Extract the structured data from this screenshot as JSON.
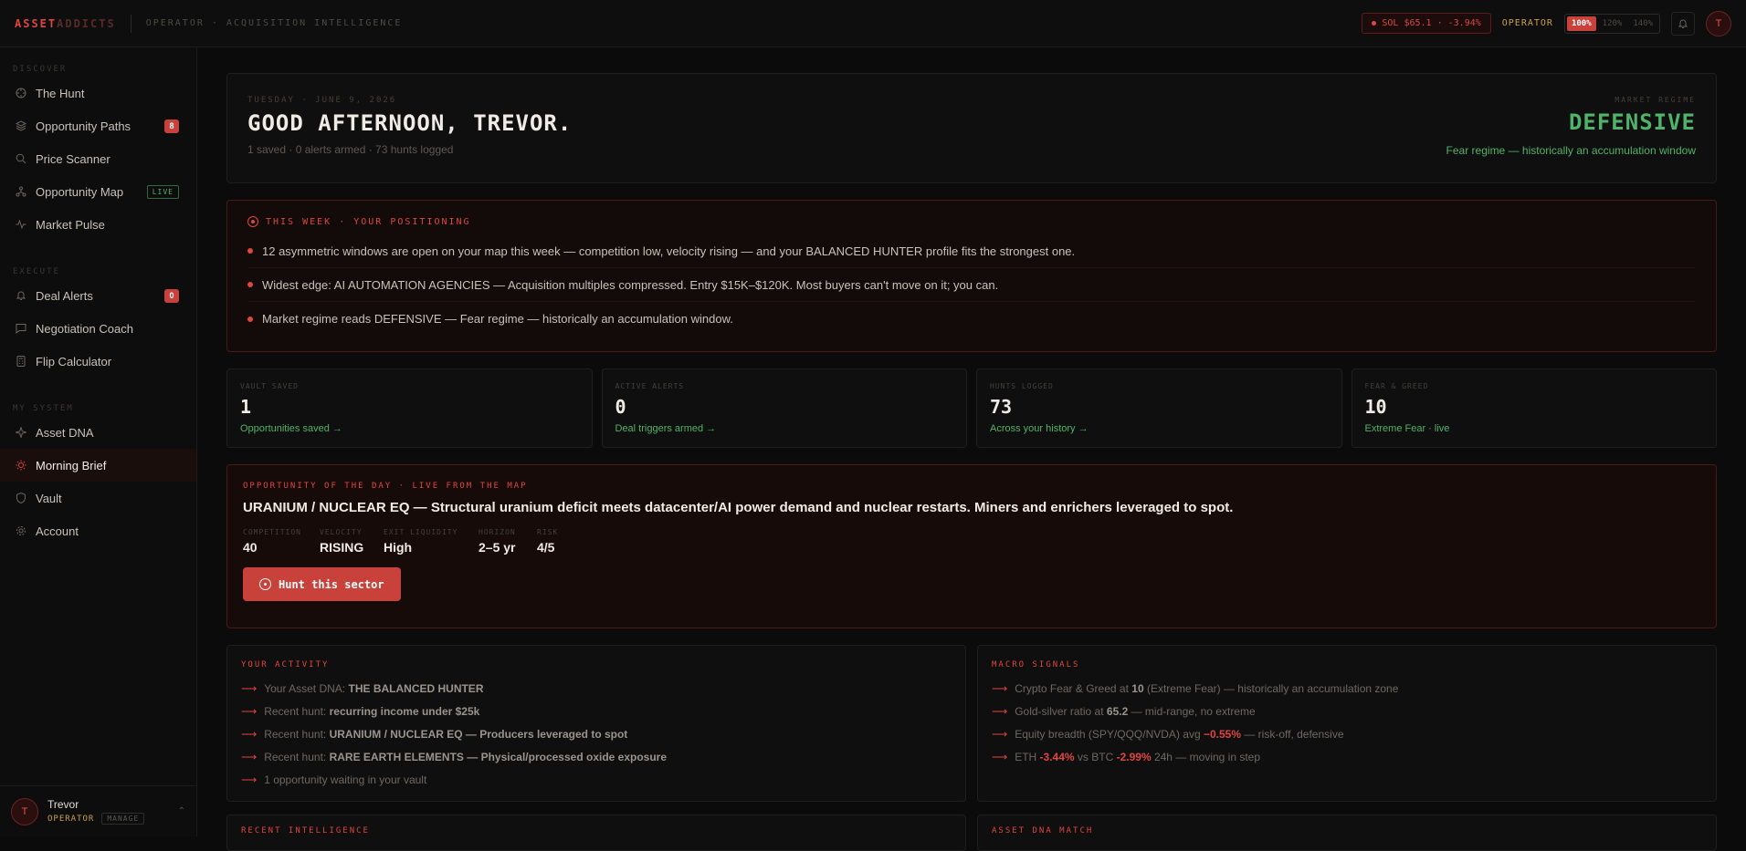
{
  "topbar": {
    "logo_a": "ASSET",
    "logo_b": "ADDICTS",
    "crumb": "OPERATOR · ACQUISITION INTELLIGENCE",
    "ticker": "SOL $65.1 · -3.94%",
    "role": "OPERATOR",
    "zoom": [
      "100%",
      "120%",
      "140%"
    ],
    "avatar": "T"
  },
  "sidebar": {
    "sections": [
      {
        "label": "DISCOVER",
        "items": [
          {
            "label": "The Hunt",
            "icon": "crosshair-icon"
          },
          {
            "label": "Opportunity Paths",
            "icon": "layers-icon",
            "badge": "8"
          },
          {
            "label": "Price Scanner",
            "icon": "search-icon"
          },
          {
            "label": "Opportunity Map",
            "icon": "network-icon",
            "tag": "LIVE"
          },
          {
            "label": "Market Pulse",
            "icon": "pulse-icon"
          }
        ]
      },
      {
        "label": "EXECUTE",
        "items": [
          {
            "label": "Deal Alerts",
            "icon": "bell-icon",
            "badge": "0"
          },
          {
            "label": "Negotiation Coach",
            "icon": "chat-icon"
          },
          {
            "label": "Flip Calculator",
            "icon": "calculator-icon"
          }
        ]
      },
      {
        "label": "MY SYSTEM",
        "items": [
          {
            "label": "Asset DNA",
            "icon": "sparkle-icon"
          },
          {
            "label": "Morning Brief",
            "icon": "sun-icon"
          },
          {
            "label": "Vault",
            "icon": "shield-icon"
          },
          {
            "label": "Account",
            "icon": "gear-icon"
          }
        ]
      }
    ],
    "user": {
      "name": "Trevor",
      "role": "OPERATOR",
      "manage": "MANAGE",
      "initial": "T"
    }
  },
  "hero": {
    "date": "TUESDAY · JUNE 9, 2026",
    "greeting": "GOOD AFTERNOON, TREVOR.",
    "meta": "1 saved · 0 alerts armed · 73 hunts logged",
    "regime_label": "MARKET REGIME",
    "regime_value": "DEFENSIVE",
    "regime_sub": "Fear regime — historically an accumulation window"
  },
  "week": {
    "title": "THIS WEEK · YOUR POSITIONING",
    "bullets": [
      "12 asymmetric windows are open on your map this week — competition low, velocity rising — and your BALANCED HUNTER profile fits the strongest one.",
      "Widest edge: AI AUTOMATION AGENCIES — Acquisition multiples compressed. Entry $15K–$120K. Most buyers can't move on it; you can.",
      "Market regime reads DEFENSIVE — Fear regime — historically an accumulation window."
    ]
  },
  "stats": [
    {
      "label": "VAULT SAVED",
      "value": "1",
      "sub": "Opportunities saved →"
    },
    {
      "label": "ACTIVE ALERTS",
      "value": "0",
      "sub": "Deal triggers armed →"
    },
    {
      "label": "HUNTS LOGGED",
      "value": "73",
      "sub": "Across your history →"
    },
    {
      "label": "FEAR & GREED",
      "value": "10",
      "sub": "Extreme Fear · live"
    }
  ],
  "otd": {
    "label": "OPPORTUNITY OF THE DAY · LIVE FROM THE MAP",
    "headline": "URANIUM / NUCLEAR EQ — Structural uranium deficit meets datacenter/AI power demand and nuclear restarts. Miners and enrichers leveraged to spot.",
    "metrics": [
      {
        "label": "COMPETITION",
        "value": "40"
      },
      {
        "label": "VELOCITY",
        "value": "RISING"
      },
      {
        "label": "EXIT LIQUIDITY",
        "value": "High"
      },
      {
        "label": "HORIZON",
        "value": "2–5 yr"
      },
      {
        "label": "RISK",
        "value": "4/5"
      }
    ],
    "button": "Hunt this sector"
  },
  "activity": {
    "title": "YOUR ACTIVITY",
    "rows": [
      {
        "pre": "Your Asset DNA: ",
        "bold": "THE BALANCED HUNTER",
        "post": ""
      },
      {
        "pre": "Recent hunt: ",
        "bold": "recurring income under $25k",
        "post": ""
      },
      {
        "pre": "Recent hunt: ",
        "bold": "URANIUM / NUCLEAR EQ — Producers leveraged to spot",
        "post": ""
      },
      {
        "pre": "Recent hunt: ",
        "bold": "RARE EARTH ELEMENTS — Physical/processed oxide exposure",
        "post": ""
      },
      {
        "pre": "1 opportunity waiting in your vault",
        "bold": "",
        "post": ""
      }
    ]
  },
  "macro": {
    "title": "MACRO SIGNALS",
    "rows": [
      {
        "a": "Crypto Fear & Greed at ",
        "b": "10",
        "c": " (Extreme Fear) — historically an accumulation zone"
      },
      {
        "a": "Gold-silver ratio at ",
        "b": "65.2",
        "c": " — mid-range, no extreme"
      },
      {
        "a": "Equity breadth (SPY/QQQ/NVDA) avg ",
        "r": "−0.55%",
        "c": " — risk-off, defensive"
      },
      {
        "a": "ETH ",
        "r": "-3.44%",
        "m": " vs BTC ",
        "r2": "-2.99%",
        "c": " 24h — moving in step"
      }
    ]
  },
  "peek": {
    "left": "RECENT INTELLIGENCE",
    "right": "ASSET DNA MATCH"
  },
  "colors": {
    "accent": "#e0453f",
    "positive": "#4fb36a",
    "gold": "#c9a14a",
    "bg": "#0b0b0b"
  }
}
